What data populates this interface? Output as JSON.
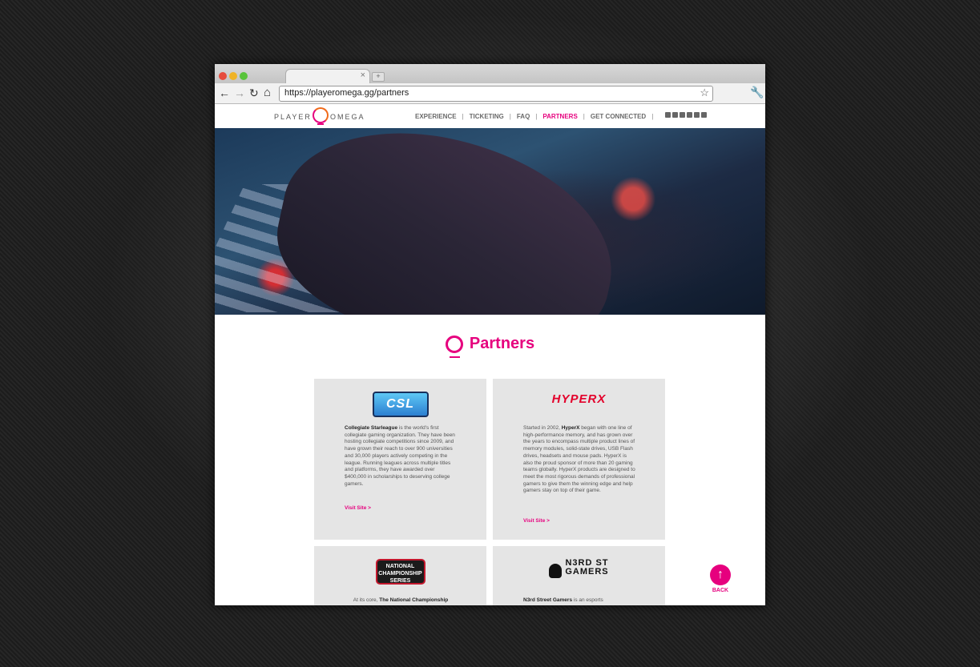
{
  "browser": {
    "url": "https://playeromega.gg/partners",
    "tab_close": "×",
    "new_tab": "+",
    "back_glyph": "←",
    "forward_glyph": "→",
    "reload_glyph": "↻",
    "home_glyph": "⌂",
    "star_glyph": "☆",
    "wrench_glyph": "🔧",
    "traffic_lights": [
      "#e64b3c",
      "#f0b327",
      "#58c33a"
    ]
  },
  "site": {
    "logo_left": "PLAYER",
    "logo_right": "OMEGA",
    "nav": [
      "EXPERIENCE",
      "TICKETING",
      "FAQ",
      "PARTNERS",
      "GET CONNECTED"
    ],
    "nav_active": "PARTNERS",
    "social_icons": [
      "facebook-icon",
      "instagram-icon",
      "twitter-icon",
      "youtube-icon",
      "twitch-icon",
      "discord-icon"
    ],
    "accent": "#e6007e"
  },
  "section": {
    "title": "Partners"
  },
  "cards": [
    {
      "logo_text": "CSL",
      "body_bold": "Collegiate Starleague",
      "body": " is the world's first collegiate gaming organization. They have been hosting collegiate competitions since 2009, and have grown their reach to over 900 universities and 30,000 players actively competing in the league. Running leagues across multiple titles and platforms, they have awarded over $400,000 in scholarships to deserving college gamers.",
      "visit": "Visit Site >"
    },
    {
      "logo_text": "HYPERX",
      "body_pre": "Started in 2002, ",
      "body_bold": "HyperX",
      "body": " began with one line of high-performance memory, and has grown over the years to encompass multiple product lines of memory modules, solid-state drives, USB Flash drives, headsets and mouse pads. HyperX is also the proud sponsor of more than 20 gaming teams globally. HyperX products are designed to meet the most rigorous demands of professional gamers to give them the winning edge and help gamers stay on top of their game.",
      "visit": "Visit Site >"
    },
    {
      "logo_line1": "NATIONAL",
      "logo_line2": "CHAMPIONSHIP",
      "logo_line3": "SERIES",
      "body_pre": "At its core, ",
      "body_bold": "The National Championship"
    },
    {
      "logo_line1": "N3RD ST",
      "logo_line2": "GAMERS",
      "body_bold": "N3rd Street Gamers",
      "body": " is an esports"
    }
  ],
  "back": {
    "glyph": "↑",
    "label": "BACK"
  }
}
